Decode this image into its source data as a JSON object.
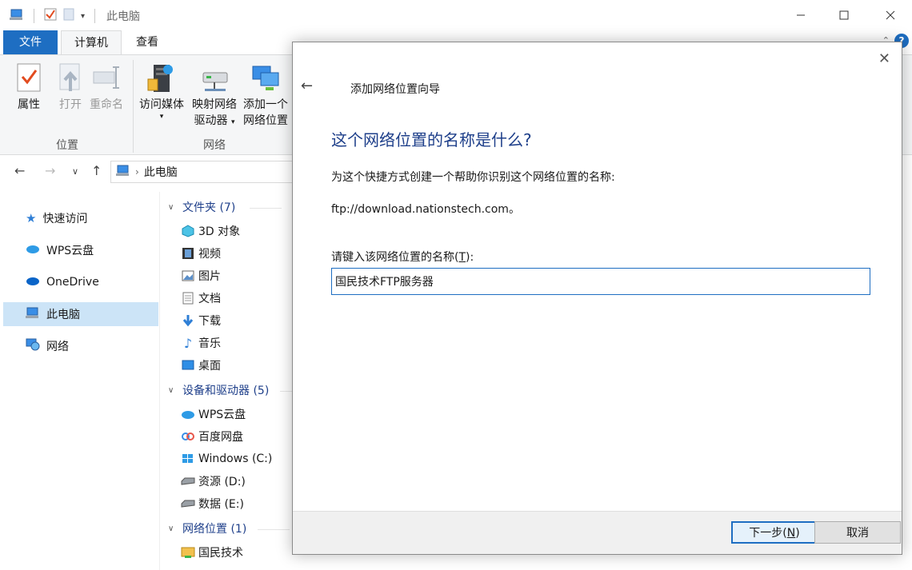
{
  "window": {
    "title": "此电脑"
  },
  "ribbon": {
    "tabs": [
      "文件",
      "计算机",
      "查看"
    ],
    "items": {
      "properties": "属性",
      "open": "打开",
      "rename": "重命名",
      "access_media_1": "访问媒体",
      "map_drive_1": "映射网络",
      "map_drive_2": "驱动器",
      "add_location_1": "添加一个",
      "add_location_2": "网络位置"
    },
    "groups": {
      "location": "位置",
      "network": "网络"
    }
  },
  "address": {
    "path": "此电脑"
  },
  "navpane": {
    "items": [
      "快速访问",
      "WPS云盘",
      "OneDrive",
      "此电脑",
      "网络"
    ]
  },
  "content": {
    "groups": {
      "folders": "文件夹 (7)",
      "devices": "设备和驱动器 (5)",
      "netloc": "网络位置 (1)"
    },
    "folders": [
      "3D 对象",
      "视频",
      "图片",
      "文档",
      "下载",
      "音乐",
      "桌面"
    ],
    "devices": [
      "WPS云盘",
      "百度网盘",
      "Windows (C:)",
      "资源 (D:)",
      "数据 (E:)"
    ],
    "netloc": [
      "国民技术"
    ]
  },
  "dialog": {
    "title": "添加网络位置向导",
    "heading": "这个网络位置的名称是什么?",
    "description": "为这个快捷方式创建一个帮助你识别这个网络位置的名称:",
    "url": "ftp://download.nationstech.com。",
    "prompt_prefix": "请键入该网络位置的名称(",
    "prompt_key": "T",
    "prompt_suffix": "):",
    "input_value": "国民技术FTP服务器",
    "next_prefix": "下一步(",
    "next_key": "N",
    "next_suffix": ")",
    "cancel": "取消"
  },
  "colors": {
    "accent": "#1e6ec2",
    "heading": "#1e3f8a",
    "selection": "#cce4f7"
  }
}
